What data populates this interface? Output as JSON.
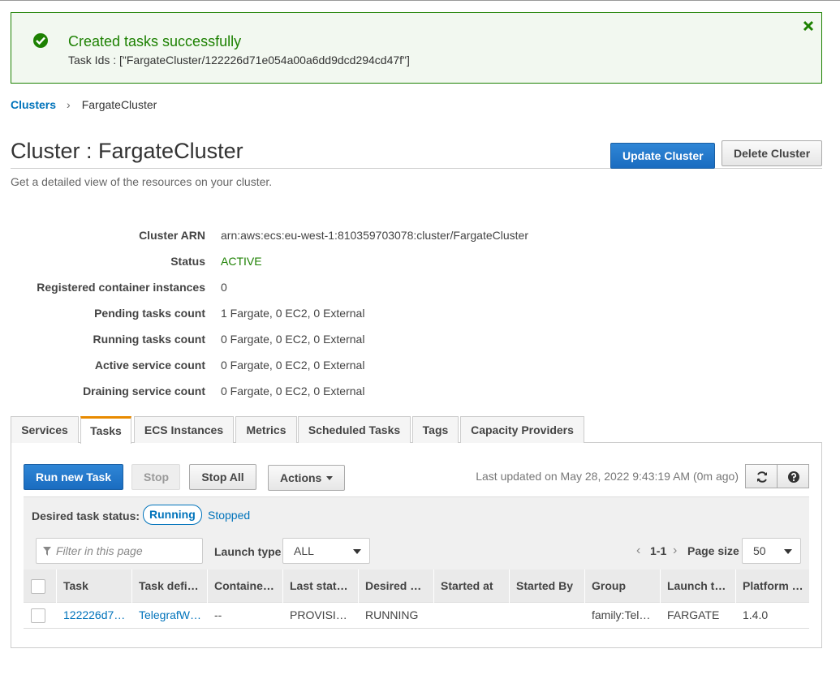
{
  "flash": {
    "title": "Created tasks successfully",
    "message": "Task Ids : [\"FargateCluster/122226d71e054a00a6dd9dcd294cd47f\"]",
    "icon": "check-circle-icon",
    "close_icon": "close-icon",
    "color": "#1d8102"
  },
  "breadcrumb": {
    "root": "Clusters",
    "separator": "›",
    "current": "FargateCluster"
  },
  "header": {
    "title": "Cluster : FargateCluster",
    "subtitle": "Get a detailed view of the resources on your cluster.",
    "update_button": "Update Cluster",
    "delete_button": "Delete Cluster"
  },
  "details": [
    {
      "label": "Cluster ARN",
      "value": "arn:aws:ecs:eu-west-1:810359703078:cluster/FargateCluster"
    },
    {
      "label": "Status",
      "value": "ACTIVE"
    },
    {
      "label": "Registered container instances",
      "value": "0"
    },
    {
      "label": "Pending tasks count",
      "value": "1 Fargate, 0 EC2, 0 External"
    },
    {
      "label": "Running tasks count",
      "value": "0 Fargate, 0 EC2, 0 External"
    },
    {
      "label": "Active service count",
      "value": "0 Fargate, 0 EC2, 0 External"
    },
    {
      "label": "Draining service count",
      "value": "0 Fargate, 0 EC2, 0 External"
    }
  ],
  "tabs": [
    {
      "label": "Services"
    },
    {
      "label": "Tasks",
      "active": true
    },
    {
      "label": "ECS Instances"
    },
    {
      "label": "Metrics"
    },
    {
      "label": "Scheduled Tasks"
    },
    {
      "label": "Tags"
    },
    {
      "label": "Capacity Providers"
    }
  ],
  "toolbar": {
    "run_new_task": "Run new Task",
    "stop": "Stop",
    "stop_all": "Stop All",
    "actions": "Actions",
    "last_updated": "Last updated on May 28, 2022 9:43:19 AM (0m ago)",
    "refresh_icon": "refresh-icon",
    "help_icon": "help-icon"
  },
  "filters": {
    "desired_status_label": "Desired task status:",
    "running": "Running",
    "stopped": "Stopped",
    "filter_placeholder": "Filter in this page",
    "launch_type_label": "Launch type",
    "launch_type_value": "ALL",
    "pager_prev": "‹",
    "pager_range": "1-1",
    "pager_next": "›",
    "page_size_label": "Page size",
    "page_size_value": "50"
  },
  "table": {
    "columns": [
      "Task",
      "Task defi…",
      "Containe…",
      "Last stat…",
      "Desired …",
      "Started at",
      "Started By",
      "Group",
      "Launch t…",
      "Platform …"
    ],
    "rows": [
      [
        "122226d7…",
        "TelegrafW…",
        "--",
        "PROVISI…",
        "RUNNING",
        "",
        "",
        "family:Tel…",
        "FARGATE",
        "1.4.0"
      ]
    ]
  }
}
